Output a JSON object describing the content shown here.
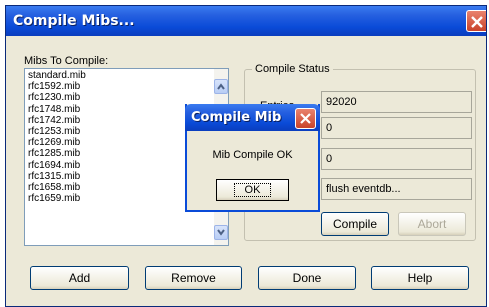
{
  "window": {
    "title": "Compile Mibs..."
  },
  "mibs_label": "Mibs To Compile:",
  "mib_list": [
    "standard.mib",
    "rfc1592.mib",
    "rfc1230.mib",
    "rfc1748.mib",
    "rfc1742.mib",
    "rfc1253.mib",
    "rfc1269.mib",
    "rfc1285.mib",
    "rfc1694.mib",
    "rfc1315.mib",
    "rfc1658.mib",
    "rfc1659.mib"
  ],
  "status": {
    "legend": "Compile Status",
    "entries_label": "Entries",
    "field1": "92020",
    "field2": "0",
    "field3": "0",
    "field4": "flush eventdb..."
  },
  "buttons": {
    "compile": "Compile",
    "abort": "Abort",
    "add": "Add",
    "remove": "Remove",
    "done": "Done",
    "help": "Help"
  },
  "dialog": {
    "title": "Compile Mib",
    "message": "Mib Compile OK",
    "ok": "OK"
  },
  "icons": {
    "close": "close-icon",
    "scroll_up": "chevron-up-icon",
    "scroll_down": "chevron-down-icon"
  },
  "colors": {
    "titlebar": "#0a4bd8",
    "close": "#c9432a",
    "panel": "#ece9d8"
  }
}
